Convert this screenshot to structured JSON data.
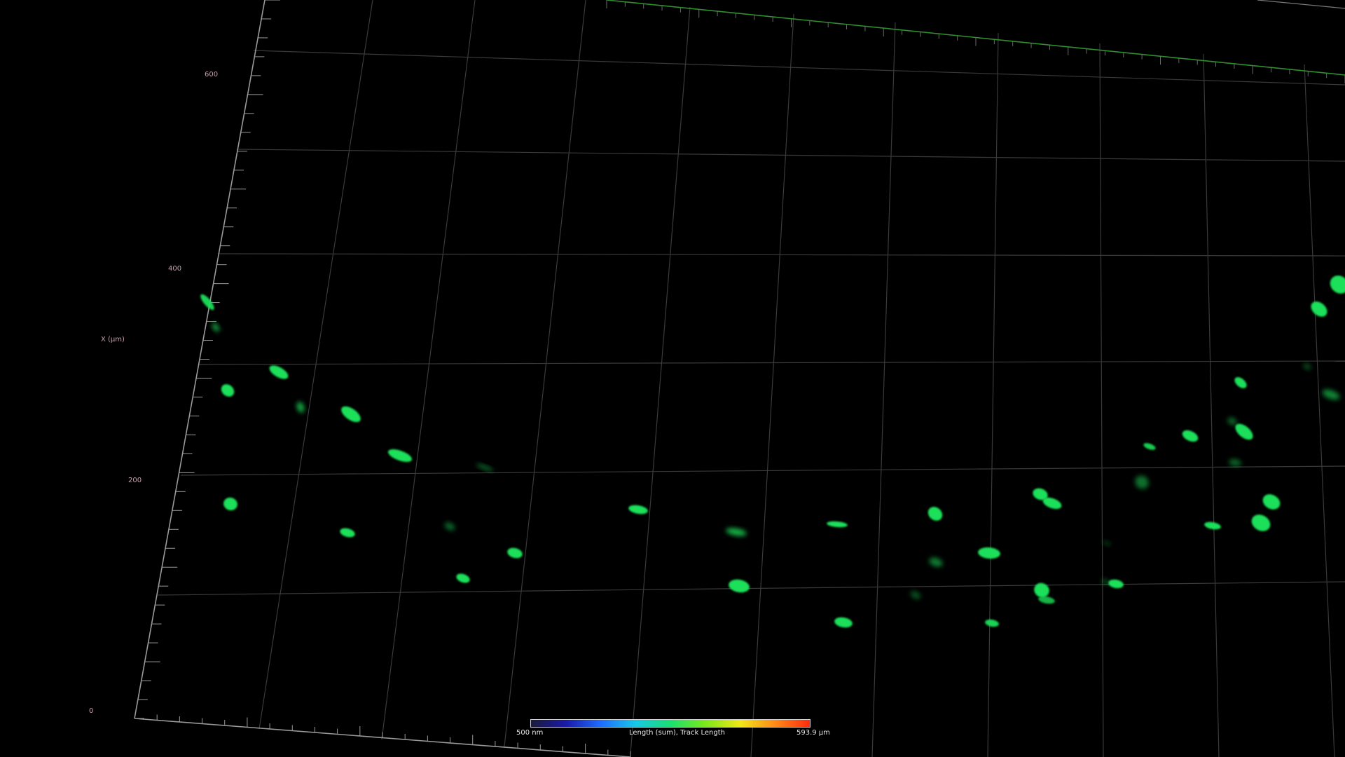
{
  "axis": {
    "title": "X (µm)",
    "ticks": [
      "600",
      "400",
      "200",
      "0"
    ]
  },
  "colorbar": {
    "min_label": "500 nm",
    "title": "Length (sum), Track Length",
    "max_label": "593.9 µm",
    "gradient_colors": [
      "#1b1b3a",
      "#1a1aa8",
      "#1f6cff",
      "#18c8e8",
      "#19e070",
      "#7be81a",
      "#f0e818",
      "#ff8a18",
      "#ff2a10"
    ]
  },
  "colors": {
    "background": "#000000",
    "grid_line": "#3a3a3a",
    "axis_line": "#9a9a9a",
    "top_edge": "#2f8f2f",
    "cell_fill": "#1de05a",
    "label": "#c9a0ac"
  },
  "cells": {
    "count": 56
  }
}
